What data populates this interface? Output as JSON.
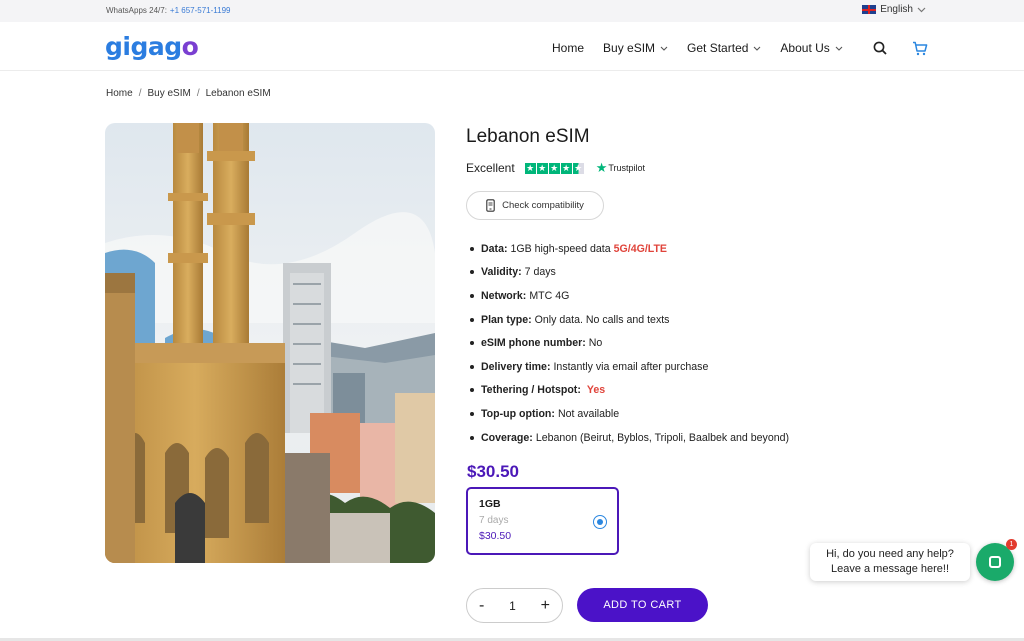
{
  "topbar": {
    "contact_label": "WhatsApps 24/7:",
    "phone": "+1 657-571-1199",
    "language": "English"
  },
  "header": {
    "logo_text_a": "gigag",
    "logo_text_b": "o",
    "nav": [
      {
        "label": "Home"
      },
      {
        "label": "Buy eSIM"
      },
      {
        "label": "Get Started"
      },
      {
        "label": "About Us"
      }
    ]
  },
  "breadcrumb": [
    "Home",
    "Buy eSIM",
    "Lebanon eSIM"
  ],
  "product": {
    "title": "Lebanon eSIM",
    "rating_label": "Excellent",
    "trustpilot_label": "Trustpilot",
    "rating_stars": 4.5,
    "compat_label": "Check compatibility",
    "specs": [
      {
        "label": "Data:",
        "value": "1GB high-speed data",
        "highlight": "5G/4G/LTE"
      },
      {
        "label": "Validity:",
        "value": "7 days"
      },
      {
        "label": "Network:",
        "value": "MTC 4G"
      },
      {
        "label": "Plan type:",
        "value": "Only data. No calls and texts"
      },
      {
        "label": "eSIM phone number:",
        "value": "No"
      },
      {
        "label": "Delivery time:",
        "value": "Instantly via email after purchase"
      },
      {
        "label": "Tethering / Hotspot:",
        "value": "",
        "highlight": "Yes"
      },
      {
        "label": "Top-up option:",
        "value": "Not available"
      },
      {
        "label": "Coverage:",
        "value": "Lebanon (Beirut, Byblos, Tripoli, Baalbek and beyond)"
      }
    ],
    "price": "$30.50",
    "plan": {
      "name": "1GB",
      "days": "7 days",
      "price": "$30.50",
      "selected": true
    },
    "quantity": "1",
    "minus": "-",
    "plus": "+",
    "add_to_cart": "ADD TO CART"
  },
  "chat": {
    "line1": "Hi, do you need any help?",
    "line2": "Leave a message here!!",
    "badge": "1"
  },
  "colors": {
    "brand_blue": "#2b7de0",
    "brand_purple": "#4b18b8",
    "highlight_red": "#e0443b",
    "trustpilot_green": "#00b67a",
    "chat_green": "#1aaa6a"
  }
}
